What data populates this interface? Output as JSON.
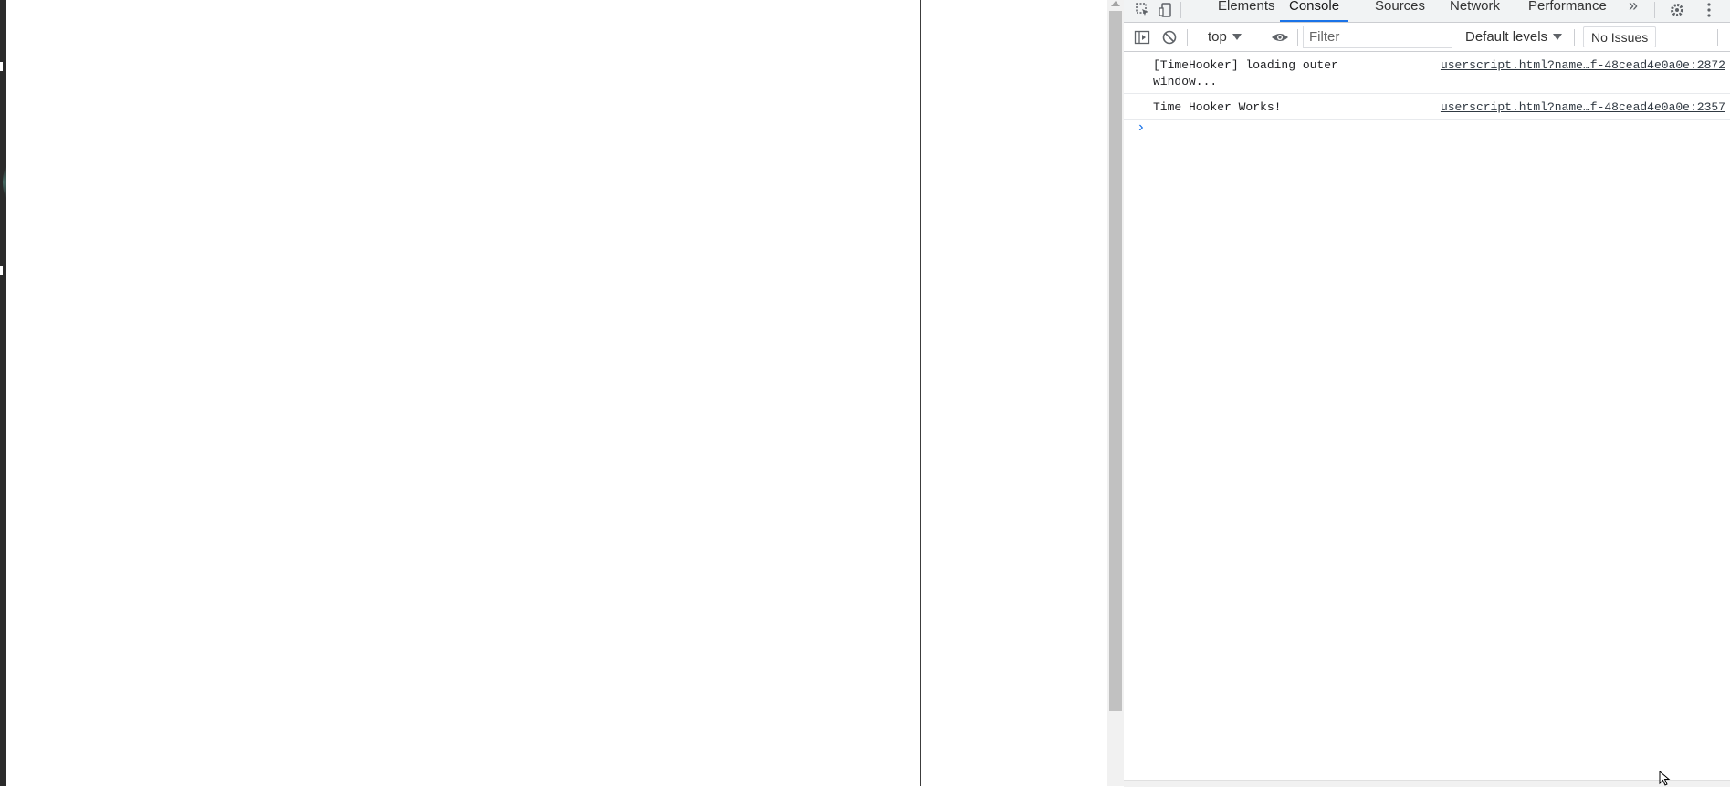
{
  "devtools": {
    "tabs": [
      {
        "label": "Elements"
      },
      {
        "label": "Console"
      },
      {
        "label": "Sources"
      },
      {
        "label": "Network"
      },
      {
        "label": "Performance"
      }
    ],
    "active_tab": "Console",
    "overflow_label": "»",
    "toolbar": {
      "context": "top",
      "filter_placeholder": "Filter",
      "levels": "Default levels",
      "issues": "No Issues"
    },
    "console": {
      "messages": [
        {
          "text": "[TimeHooker] loading outer window...",
          "source": "userscript.html?name…f-48cead4e0a0e:2872"
        },
        {
          "text": "Time Hooker Works!",
          "source": "userscript.html?name…f-48cead4e0a0e:2357"
        }
      ],
      "prompt": "›"
    },
    "colors": {
      "accent": "#1a73e8",
      "border": "#cbcdd1",
      "tab_bar_bg": "#f1f3f4"
    }
  }
}
